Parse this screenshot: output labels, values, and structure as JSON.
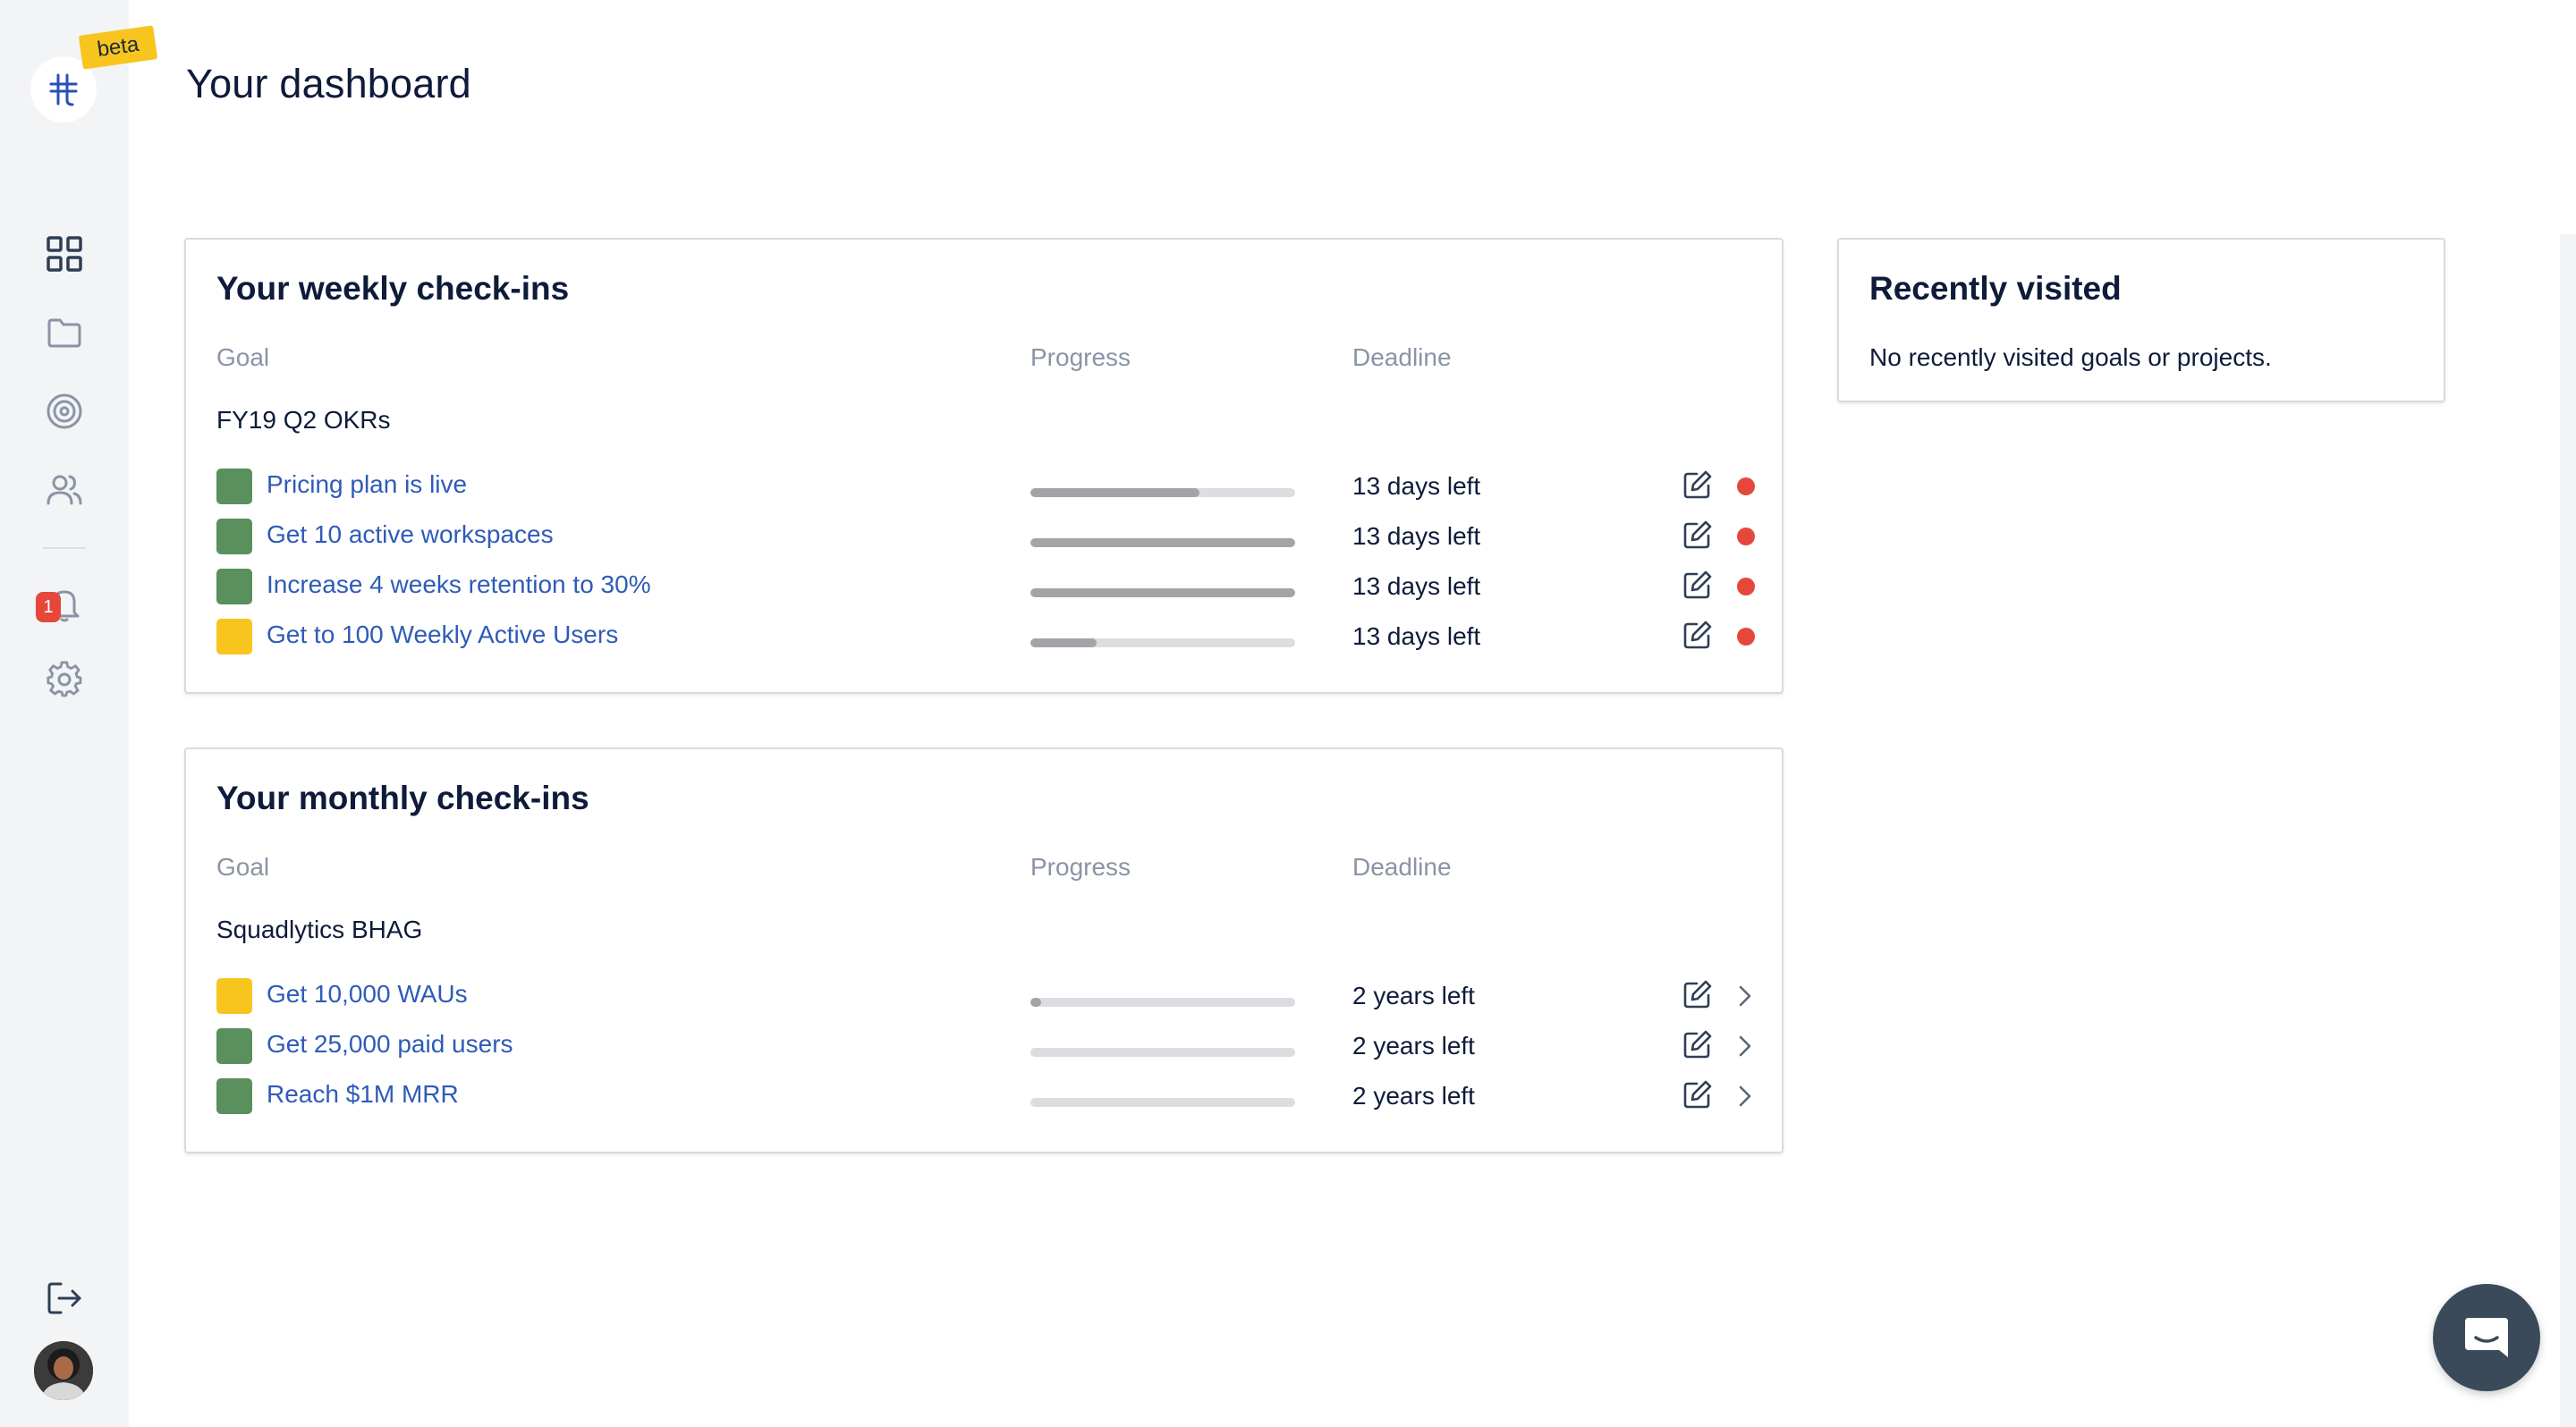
{
  "app": {
    "beta_label": "beta",
    "page_title": "Your dashboard"
  },
  "sidebar": {
    "items": [
      {
        "icon": "dashboard-grid-icon"
      },
      {
        "icon": "folder-icon"
      },
      {
        "icon": "target-icon"
      },
      {
        "icon": "people-icon"
      },
      {
        "icon": "bell-icon",
        "badge": "1"
      },
      {
        "icon": "gear-icon"
      }
    ],
    "bottom": [
      {
        "icon": "logout-icon"
      },
      {
        "icon": "avatar"
      }
    ]
  },
  "weekly": {
    "title": "Your weekly check-ins",
    "columns": {
      "goal": "Goal",
      "progress": "Progress",
      "deadline": "Deadline"
    },
    "group": "FY19 Q2 OKRs",
    "goals": [
      {
        "name": "Pricing plan is live",
        "status_color": "#5a8f5e",
        "progress": 0.64,
        "deadline": "13 days left"
      },
      {
        "name": "Get 10 active workspaces",
        "status_color": "#5a8f5e",
        "progress": 1.0,
        "deadline": "13 days left"
      },
      {
        "name": "Increase 4 weeks retention to 30%",
        "status_color": "#5a8f5e",
        "progress": 1.0,
        "deadline": "13 days left"
      },
      {
        "name": "Get to 100 Weekly Active Users",
        "status_color": "#f7c51e",
        "progress": 0.25,
        "deadline": "13 days left"
      }
    ]
  },
  "monthly": {
    "title": "Your monthly check-ins",
    "columns": {
      "goal": "Goal",
      "progress": "Progress",
      "deadline": "Deadline"
    },
    "group": "Squadlytics BHAG",
    "goals": [
      {
        "name": "Get 10,000 WAUs",
        "status_color": "#f7c51e",
        "progress": 0.04,
        "deadline": "2 years left"
      },
      {
        "name": "Get 25,000 paid users",
        "status_color": "#5a8f5e",
        "progress": 0.0,
        "deadline": "2 years left"
      },
      {
        "name": "Reach $1M MRR",
        "status_color": "#5a8f5e",
        "progress": 0.0,
        "deadline": "2 years left"
      }
    ]
  },
  "recent": {
    "title": "Recently visited",
    "empty_text": "No recently visited goals or projects."
  },
  "colors": {
    "accent_red": "#e5483b",
    "link_blue": "#2f5bb7",
    "beta_yellow": "#f7c51e"
  }
}
